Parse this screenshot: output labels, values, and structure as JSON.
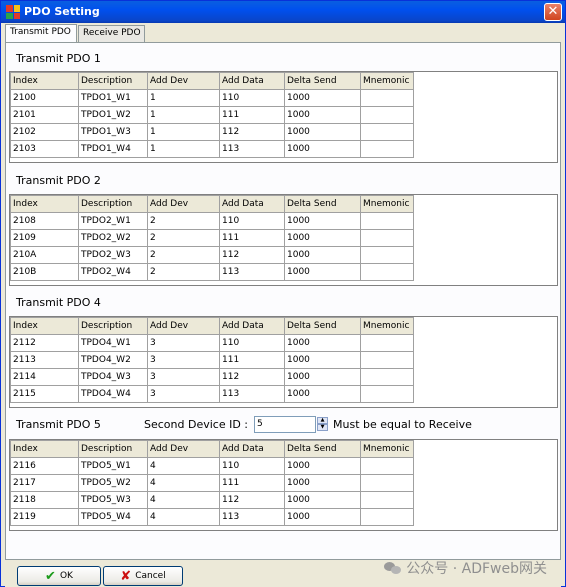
{
  "window": {
    "title": "PDO Setting"
  },
  "tabs": [
    {
      "label": "Transmit PDO",
      "active": true
    },
    {
      "label": "Receive PDO",
      "active": false
    }
  ],
  "columns": [
    "Index",
    "Description",
    "Add Dev",
    "Add Data",
    "Delta Send",
    "Mnemonic"
  ],
  "sections": [
    {
      "title": "Transmit PDO 1",
      "rows": [
        [
          "2100",
          "TPDO1_W1",
          "1",
          "110",
          "1000",
          ""
        ],
        [
          "2101",
          "TPDO1_W2",
          "1",
          "111",
          "1000",
          ""
        ],
        [
          "2102",
          "TPDO1_W3",
          "1",
          "112",
          "1000",
          ""
        ],
        [
          "2103",
          "TPDO1_W4",
          "1",
          "113",
          "1000",
          ""
        ]
      ]
    },
    {
      "title": "Transmit PDO 2",
      "rows": [
        [
          "2108",
          "TPDO2_W1",
          "2",
          "110",
          "1000",
          ""
        ],
        [
          "2109",
          "TPDO2_W2",
          "2",
          "111",
          "1000",
          ""
        ],
        [
          "210A",
          "TPDO2_W3",
          "2",
          "112",
          "1000",
          ""
        ],
        [
          "210B",
          "TPDO2_W4",
          "2",
          "113",
          "1000",
          ""
        ]
      ]
    },
    {
      "title": "Transmit PDO 4",
      "rows": [
        [
          "2112",
          "TPDO4_W1",
          "3",
          "110",
          "1000",
          ""
        ],
        [
          "2113",
          "TPDO4_W2",
          "3",
          "111",
          "1000",
          ""
        ],
        [
          "2114",
          "TPDO4_W3",
          "3",
          "112",
          "1000",
          ""
        ],
        [
          "2115",
          "TPDO4_W4",
          "3",
          "113",
          "1000",
          ""
        ]
      ]
    },
    {
      "title": "Transmit PDO 5",
      "rows": [
        [
          "2116",
          "TPDO5_W1",
          "4",
          "110",
          "1000",
          ""
        ],
        [
          "2117",
          "TPDO5_W2",
          "4",
          "111",
          "1000",
          ""
        ],
        [
          "2118",
          "TPDO5_W3",
          "4",
          "112",
          "1000",
          ""
        ],
        [
          "2119",
          "TPDO5_W4",
          "4",
          "113",
          "1000",
          ""
        ]
      ]
    }
  ],
  "second_device": {
    "label": "Second Device ID :",
    "value": "5",
    "note": "Must be equal to Receive"
  },
  "buttons": {
    "ok": "OK",
    "cancel": "Cancel"
  },
  "watermark": "公众号 · ADFweb网关",
  "colors": {
    "titlebar": "#0050ee",
    "ok_check": "#1a9a1a",
    "cancel_x": "#cc1010"
  }
}
